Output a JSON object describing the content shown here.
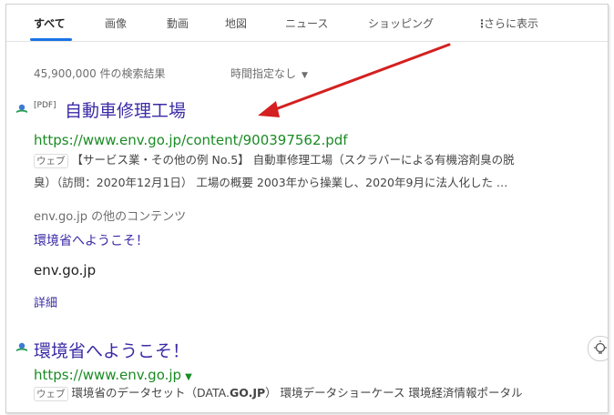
{
  "tabs": [
    {
      "label": "すべて",
      "active": true
    },
    {
      "label": "画像"
    },
    {
      "label": "動画"
    },
    {
      "label": "地図"
    },
    {
      "label": "ニュース"
    },
    {
      "label": "ショッピング"
    },
    {
      "label": "さらに表示"
    }
  ],
  "toolbar": {
    "result_count": "45,900,000 件の検索結果",
    "time_filter": "時間指定なし"
  },
  "results": [
    {
      "type_tag": "[PDF]",
      "title": "自動車修理工場",
      "url": "https://www.env.go.jp/content/900397562.pdf",
      "web_tag": "ウェブ",
      "snippet_line1": "【サービス業・その他の例 No.5】 自動車修理工場（スクラバーによる有機溶剤臭の脱",
      "snippet_line2": "臭）（訪問：2020年12月1日） 工場の概要 2003年から操業し、2020年9月に法人化した …",
      "sublinks_heading": "env.go.jp の他のコンテンツ",
      "sublink": "環境省へようこそ！",
      "sublink_domain": "env.go.jp",
      "details": "詳細"
    },
    {
      "title": "環境省へようこそ！",
      "url": "https://www.env.go.jp",
      "web_tag": "ウェブ",
      "snippet_a": "環境省のデータセット（DATA.",
      "snippet_bold": "GO.JP",
      "snippet_b": "） 環境データショーケース 環境経済情報ポータル"
    }
  ],
  "colors": {
    "annotation_arrow": "#d42020",
    "link": "#3b2ba6",
    "url": "#1a8b24"
  },
  "icons": {
    "favicon": "env-ministry-favicon",
    "more": "vertical-dots-icon",
    "bulb": "lightbulb-icon"
  }
}
